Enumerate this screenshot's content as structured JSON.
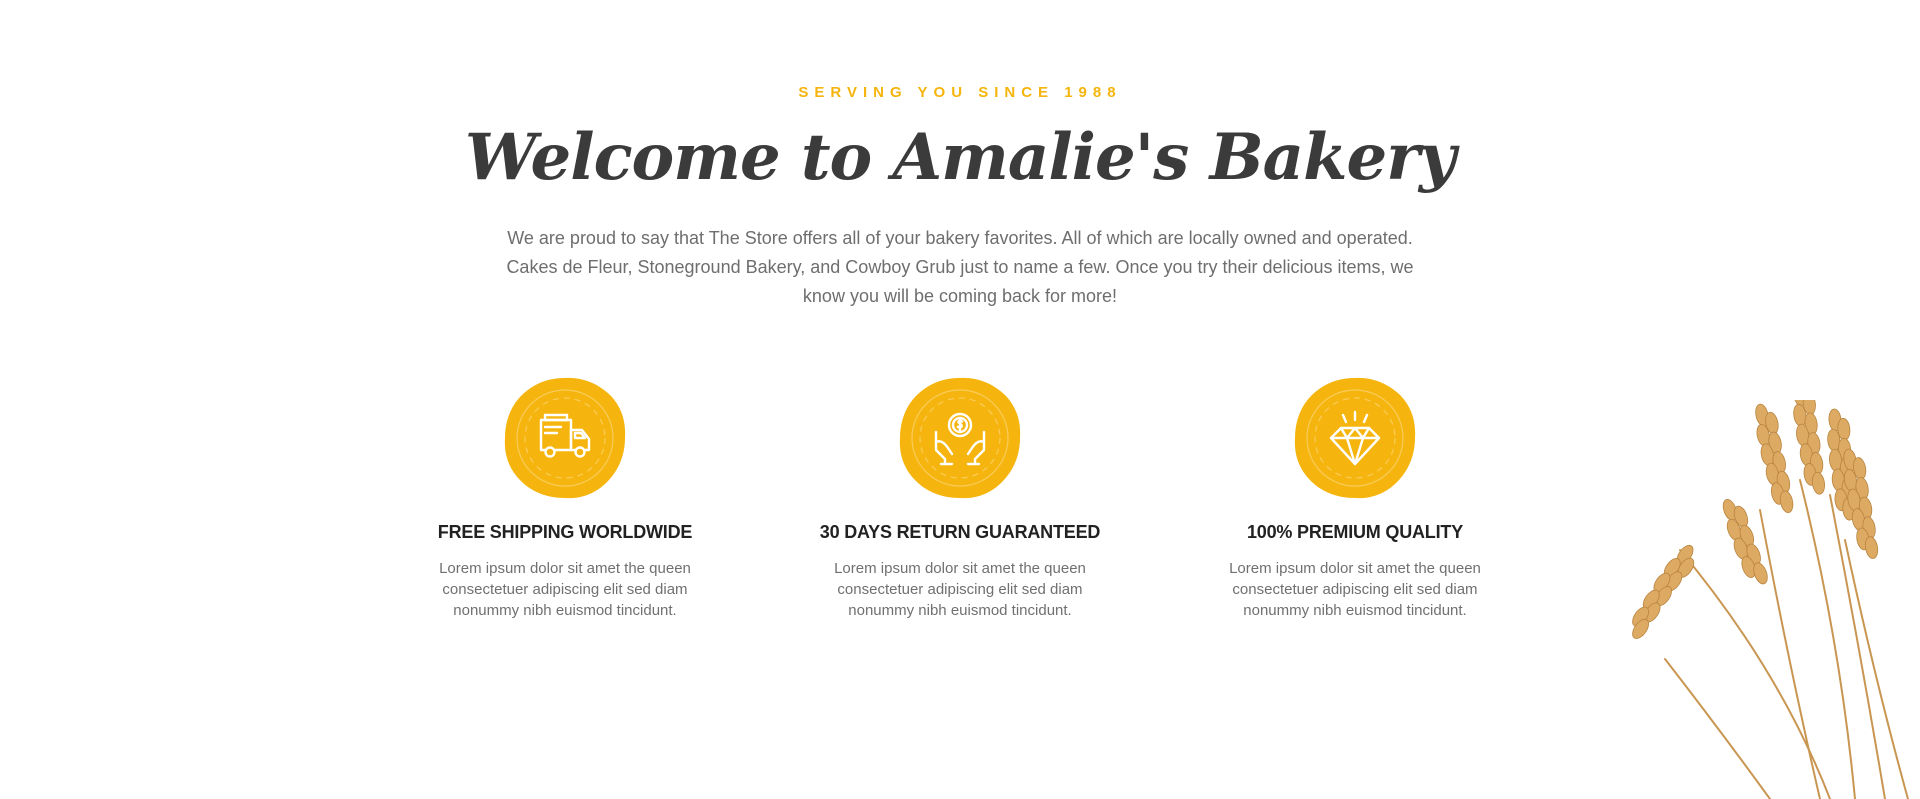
{
  "header": {
    "eyebrow": "SERVING YOU SINCE 1988",
    "title": "Welcome to Amalie's Bakery",
    "intro": "We are proud to say that The Store offers all of your bakery favorites. All of which are locally owned and operated. Cakes de Fleur, Stoneground Bakery, and Cowboy Grub just to name a few. Once you try their delicious items, we know you will be coming back for more!"
  },
  "features": [
    {
      "icon": "delivery-truck-icon",
      "title": "FREE SHIPPING WORLDWIDE",
      "text": "Lorem ipsum dolor sit amet the queen consectetuer adipiscing elit sed diam nonummy nibh euismod tincidunt."
    },
    {
      "icon": "money-hands-icon",
      "title": "30 DAYS RETURN GUARANTEED",
      "text": "Lorem ipsum dolor sit amet the queen consectetuer adipiscing elit sed diam nonummy nibh euismod tincidunt."
    },
    {
      "icon": "diamond-icon",
      "title": "100% PREMIUM QUALITY",
      "text": "Lorem ipsum dolor sit amet the queen consectetuer adipiscing elit sed diam nonummy nibh euismod tincidunt."
    }
  ],
  "colors": {
    "accent": "#f5b50e",
    "heading": "#3b3b3b",
    "body_text": "#6e6e6e",
    "feature_title": "#222222",
    "wheat": "#d9a55e"
  },
  "decoration": {
    "image": "wheat-stalks-image"
  }
}
